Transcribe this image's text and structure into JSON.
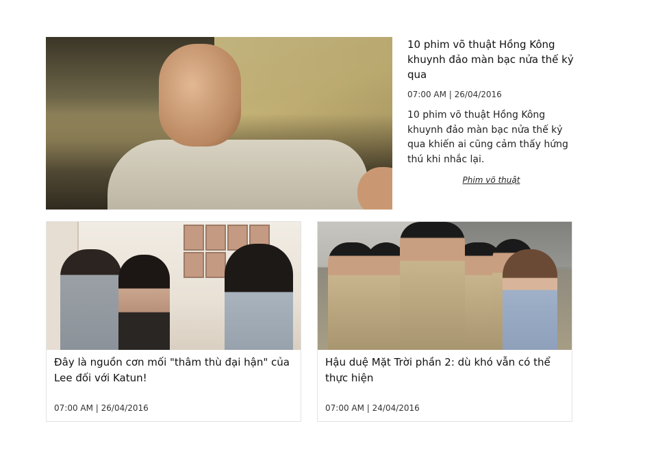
{
  "featured": {
    "title": "10 phim võ thuật Hồng Kông khuynh đảo màn bạc nửa thế kỷ qua",
    "time": "07:00 AM | 26/04/2016",
    "summary": "10 phim võ thuật Hồng Kông khuynh đảo màn bạc nửa thế kỷ qua khiến ai cũng cảm thấy hứng thú khi nhắc lại.",
    "tag": "Phim võ thuật"
  },
  "cards": [
    {
      "title": "Đây là nguồn cơn mối \"thâm thù đại hận\" của Lee đối với Katun!",
      "time": "07:00 AM | 26/04/2016"
    },
    {
      "title": "Hậu duệ Mặt Trời phần 2: dù khó vẫn có thể thực hiện",
      "time": "07:00 AM | 24/04/2016"
    }
  ]
}
